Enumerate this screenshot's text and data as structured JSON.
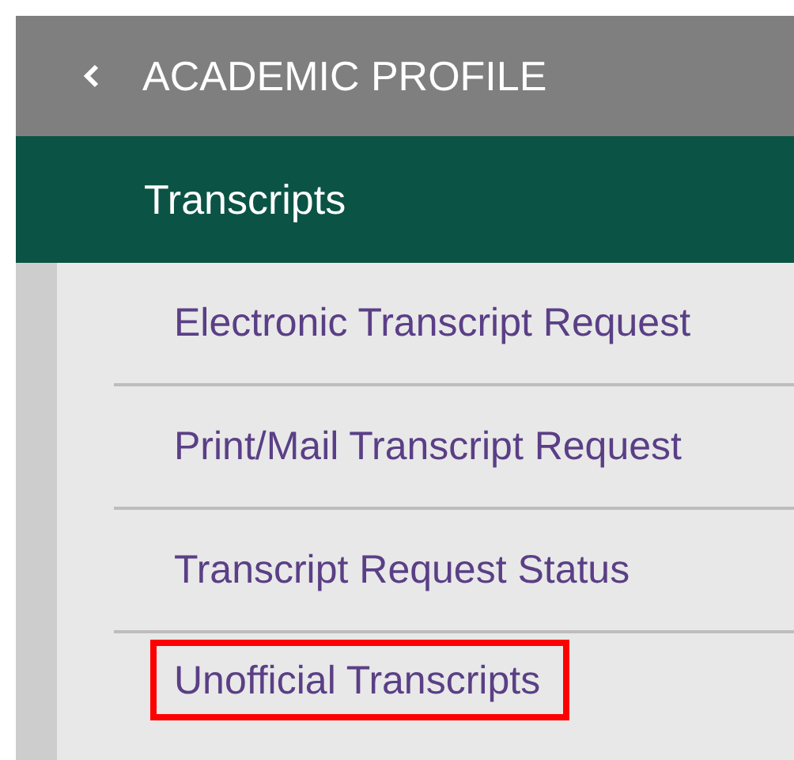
{
  "header": {
    "back_label": "ACADEMIC PROFILE"
  },
  "section": {
    "title": "Transcripts"
  },
  "menu_items": [
    {
      "label": "Electronic Transcript Request",
      "highlighted": false
    },
    {
      "label": "Print/Mail Transcript Request",
      "highlighted": false
    },
    {
      "label": "Transcript Request Status",
      "highlighted": false
    },
    {
      "label": "Unofficial Transcripts",
      "highlighted": true
    }
  ]
}
